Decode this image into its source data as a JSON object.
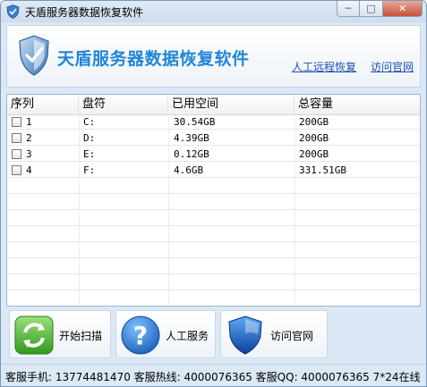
{
  "window": {
    "title": "天盾服务器数据恢复软件",
    "min_glyph": "─",
    "max_glyph": "□",
    "close_glyph": "✕"
  },
  "header": {
    "app_title": "天盾服务器数据恢复软件",
    "link_remote": "人工远程恢复",
    "link_site": "访问官网"
  },
  "table": {
    "columns": [
      "序列",
      "盘符",
      "已用空间",
      "总容量"
    ],
    "rows": [
      {
        "index": "1",
        "drive": "C:",
        "used": "30.54GB",
        "total": "200GB"
      },
      {
        "index": "2",
        "drive": "D:",
        "used": "4.39GB",
        "total": "200GB"
      },
      {
        "index": "3",
        "drive": "E:",
        "used": "0.12GB",
        "total": "200GB"
      },
      {
        "index": "4",
        "drive": "F:",
        "used": "4.6GB",
        "total": "331.51GB"
      }
    ]
  },
  "buttons": {
    "scan": "开始扫描",
    "service": "人工服务",
    "site": "访问官网"
  },
  "status": {
    "text": "客服手机: 13774481470 客服热线: 4000076365 客服QQ: 4000076365 7*24在线"
  },
  "colors": {
    "title_blue": "#1f86d6",
    "link_blue": "#1b4fb5",
    "scan_green": "#3fae2a",
    "help_blue": "#1e6fd0",
    "shield_blue": "#1d5fc8"
  },
  "icons": {
    "title": "shield-icon",
    "logo": "shield-logo-icon",
    "scan": "refresh-icon",
    "service": "question-icon",
    "site": "shield-icon"
  }
}
